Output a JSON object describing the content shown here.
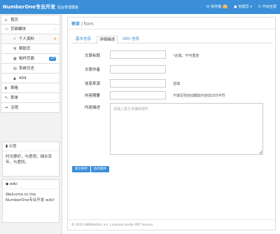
{
  "topbar": {
    "brand": "NumberOne专业开发",
    "subtitle": "后台管理模板",
    "links": [
      {
        "icon": "envelope-icon",
        "label": "收件箱",
        "badge": "3"
      },
      {
        "icon": "user-icon",
        "label": "管理员"
      },
      {
        "icon": "power-icon",
        "label": "开启全屏"
      }
    ]
  },
  "sidebar": {
    "items": [
      {
        "icon": "home-icon",
        "label": "首页"
      },
      {
        "icon": "folder-icon",
        "label": "页面模块",
        "arrow": "‹"
      },
      {
        "icon": "check-icon",
        "label": "个人资料",
        "star": "★"
      },
      {
        "icon": "wrench-icon",
        "label": "帮助页"
      },
      {
        "icon": "grid-icon",
        "label": "柏杯页面",
        "count": "24"
      },
      {
        "icon": "calendar-icon",
        "label": "系统日志"
      },
      {
        "icon": "warning-icon",
        "label": "404"
      },
      {
        "icon": "book-icon",
        "label": "表格"
      },
      {
        "icon": "pencil-icon",
        "label": "表单"
      },
      {
        "icon": "signout-icon",
        "label": "注销"
      }
    ],
    "notice": {
      "title": "公告",
      "body": "时光静好，与君语；细水流年，与君同。"
    },
    "wiki": {
      "title": "wiki",
      "body": "Welcome to the NumberOne专业开发 wiki!"
    }
  },
  "main": {
    "title_strong": "表单",
    "title_crumb": "/ form",
    "tabs": [
      "基本信息",
      "详细描述",
      "SEO 信息"
    ],
    "form": {
      "title_label": "文章标题",
      "title_help": "*必填，不可重复",
      "author_label": "文章作者",
      "source_label": "信息来源",
      "source_help": "选填",
      "summary_label": "内容摘要",
      "summary_help": "不填写则自动截取内容前255字符",
      "desc_label": "内容描述",
      "desc_placeholder": "请输入富文本编辑插件"
    },
    "buttons": {
      "submit": "提交保存",
      "save_draft": "放存稿件"
    },
    "footer": "© 2014 AllMobilize, Inc. Licensed under MIT license."
  },
  "colors": {
    "accent": "#3a8fd8",
    "badge": "#f0ad4e"
  }
}
